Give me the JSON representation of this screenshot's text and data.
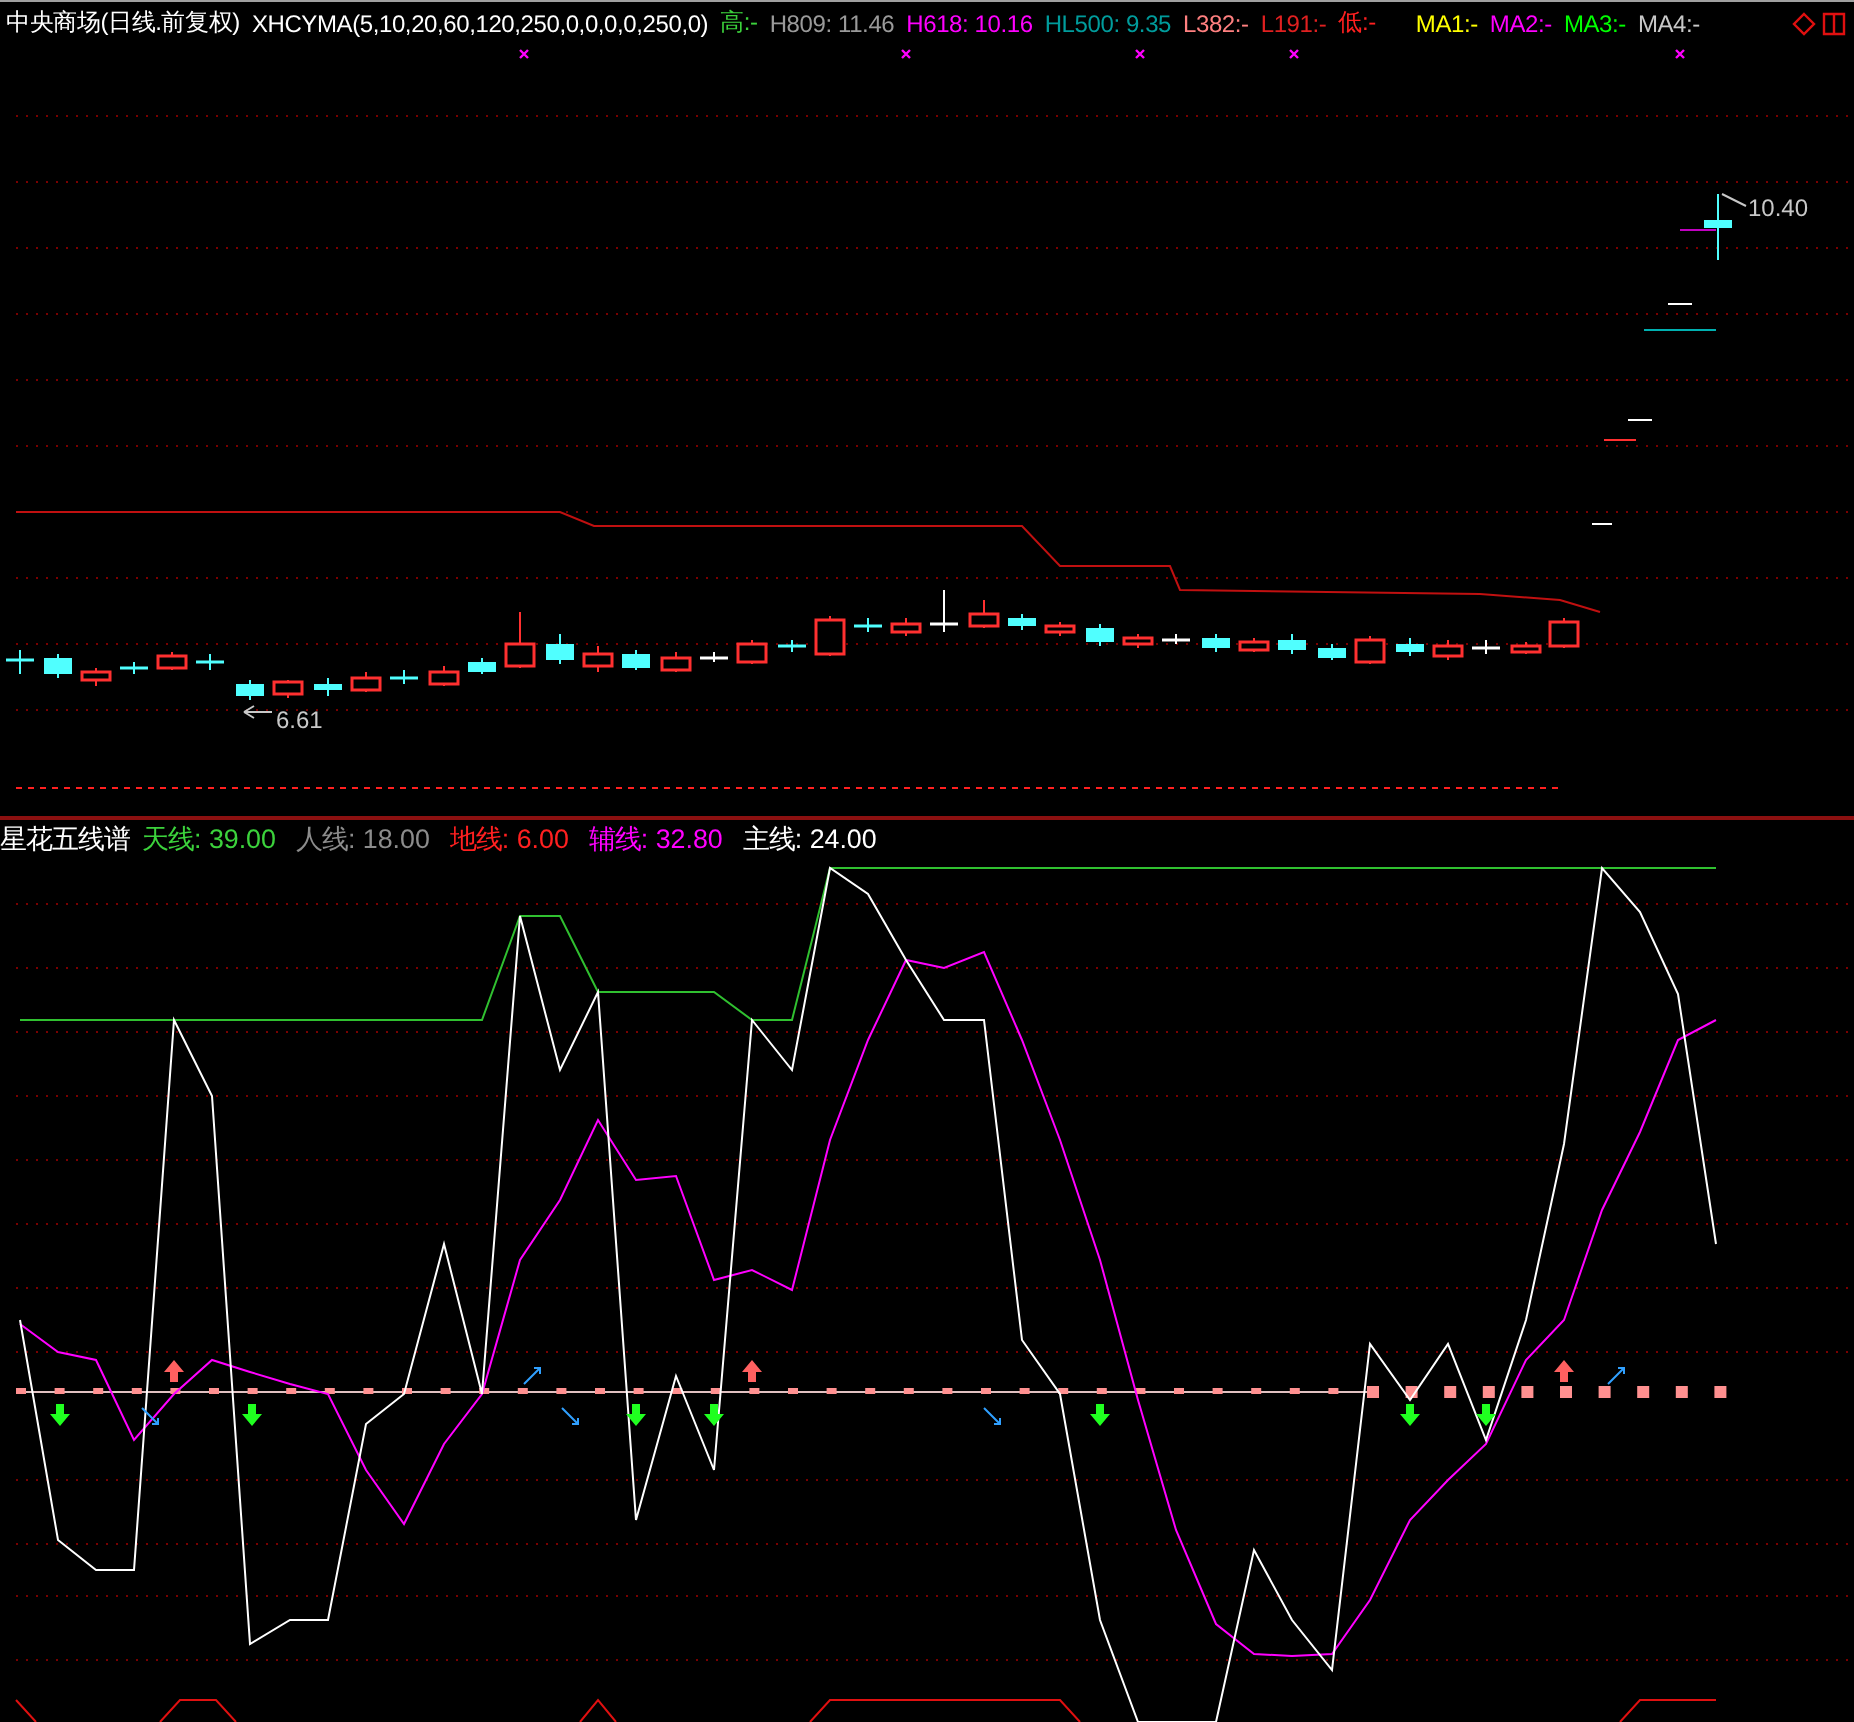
{
  "header": {
    "security": "中央商场(日线.前复权)",
    "indicator": "XHCYMA(5,10,20,60,120,250,0,0,0,0,250,0)",
    "levels": [
      {
        "text": "高:-",
        "color": "#3cd23c"
      },
      {
        "text": "H809: 11.46",
        "color": "#9a9a9a"
      },
      {
        "text": "H618: 10.16",
        "color": "#ff00ff"
      },
      {
        "text": "HL500: 9.35",
        "color": "#009c9c"
      },
      {
        "text": "L382:-",
        "color": "#ff8080"
      },
      {
        "text": "L191:-",
        "color": "#e02020"
      },
      {
        "text": "低:-",
        "color": "#ff2020"
      }
    ],
    "moving_averages": [
      {
        "text": "MA1:-",
        "color": "#ffff00"
      },
      {
        "text": "MA2:-",
        "color": "#ff00ff"
      },
      {
        "text": "MA3:-",
        "color": "#00ff00"
      },
      {
        "text": "MA4:-",
        "color": "#c8c8c8"
      }
    ]
  },
  "price_labels": {
    "high": "10.40",
    "low": "6.61"
  },
  "indicator_panel": {
    "title": "星花五线谱",
    "fields": [
      {
        "text": "天线: 39.00",
        "color": "#3cd23c"
      },
      {
        "text": "人线: 18.00",
        "color": "#8c8c8c"
      },
      {
        "text": "地线: 6.00",
        "color": "#ff2020"
      },
      {
        "text": "辅线: 32.80",
        "color": "#ff00ff"
      },
      {
        "text": "主线: 24.00",
        "color": "#ffffff"
      }
    ]
  }
}
